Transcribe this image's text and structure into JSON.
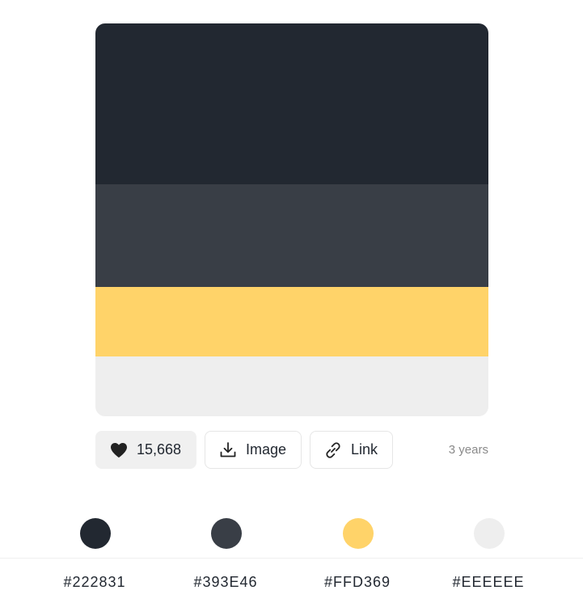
{
  "palette": {
    "colors": [
      "#222831",
      "#393E46",
      "#FFD369",
      "#EEEEEE"
    ]
  },
  "actions": {
    "likes": "15,668",
    "image_label": "Image",
    "link_label": "Link",
    "time": "3 years"
  },
  "icons": {
    "like": "heart-icon",
    "image": "download-icon",
    "link": "link-icon"
  },
  "hex_labels": [
    "#222831",
    "#393E46",
    "#FFD369",
    "#EEEEEE"
  ]
}
